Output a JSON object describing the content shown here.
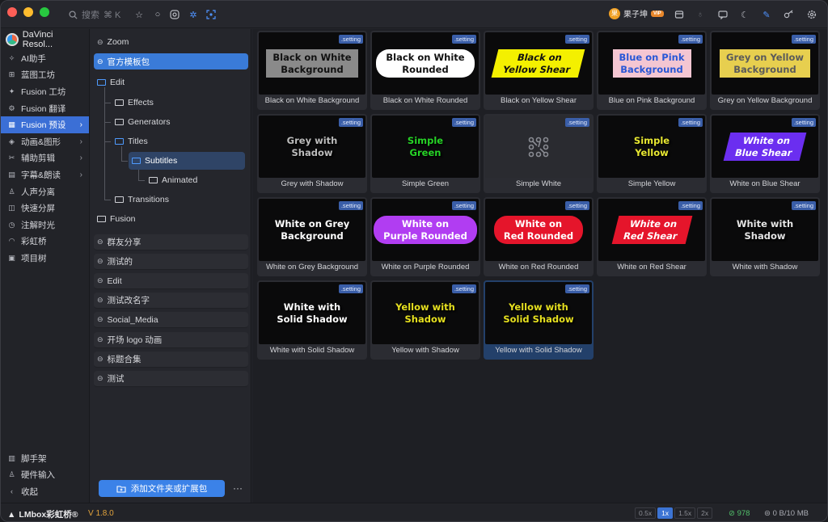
{
  "titlebar": {
    "search_placeholder": "搜索",
    "shortcut": "⌘ K",
    "user_name": "果子坤",
    "vip_label": "VIP",
    "avatar_glyph": "果"
  },
  "nav": {
    "brand": "DaVinci Resol...",
    "items": [
      {
        "label": "AI助手",
        "icon": "sparkle-icon"
      },
      {
        "label": "蓝图工坊",
        "icon": "blueprint-icon"
      },
      {
        "label": "Fusion 工坊",
        "icon": "wrench-icon"
      },
      {
        "label": "Fusion 翻译",
        "icon": "translate-icon"
      },
      {
        "label": "Fusion 预设",
        "icon": "grid-icon",
        "active": true,
        "chevron": true
      },
      {
        "label": "动画&图形",
        "icon": "motion-icon",
        "chevron": true
      },
      {
        "label": "辅助剪辑",
        "icon": "cut-icon",
        "chevron": true
      },
      {
        "label": "字幕&朗读",
        "icon": "subtitle-icon",
        "chevron": true
      },
      {
        "label": "人声分离",
        "icon": "voice-icon"
      },
      {
        "label": "快速分屏",
        "icon": "split-icon"
      },
      {
        "label": "注解时光",
        "icon": "clock-icon"
      },
      {
        "label": "彩虹桥",
        "icon": "rainbow-icon"
      },
      {
        "label": "项目树",
        "icon": "tree-icon"
      }
    ],
    "bottom": [
      {
        "label": "脚手架",
        "icon": "scaffold-icon"
      },
      {
        "label": "硬件输入",
        "icon": "hardware-icon"
      },
      {
        "label": "收起",
        "icon": "collapse-icon"
      }
    ]
  },
  "tree": {
    "zoom": "Zoom",
    "official": "官方模板包",
    "edit": "Edit",
    "effects": "Effects",
    "generators": "Generators",
    "titles": "Titles",
    "subtitles": "Subtitles",
    "animated": "Animated",
    "transitions": "Transitions",
    "fusion": "Fusion",
    "packages": [
      "群友分享",
      "测试的",
      "Edit",
      "测试改名字",
      "Social_Media",
      "开场 logo 动画",
      "标题合集",
      "测试"
    ],
    "add_button": "添加文件夹或扩展包",
    "more": "···"
  },
  "grid": {
    "badge": ".setting",
    "cards": [
      {
        "caption": "Black on White Background",
        "preview": "Black on White\nBackground",
        "fg": "#111111",
        "bg": "#8a8a8a",
        "shape": "rect"
      },
      {
        "caption": "Black on White Rounded",
        "preview": "Black on White\nRounded",
        "fg": "#111111",
        "bg": "#ffffff",
        "shape": "pill"
      },
      {
        "caption": "Black on Yellow Shear",
        "preview": "Black on\nYellow Shear",
        "fg": "#111111",
        "bg": "#f4f000",
        "shape": "shear"
      },
      {
        "caption": "Blue on Pink Background",
        "preview": "Blue on Pink\nBackground",
        "fg": "#2957d6",
        "bg": "#f4c6d2",
        "shape": "rect"
      },
      {
        "caption": "Grey on Yellow Background",
        "preview": "Grey on Yellow\nBackground",
        "fg": "#5a5a5a",
        "bg": "#e7cf4f",
        "shape": "rect"
      },
      {
        "caption": "Grey with Shadow",
        "preview": "Grey with\nShadow",
        "fg": "#bcbcbc",
        "bg": "",
        "shape": "none"
      },
      {
        "caption": "Simple Green",
        "preview": "Simple\nGreen",
        "fg": "#27d427",
        "bg": "",
        "shape": "none"
      },
      {
        "caption": "Simple White",
        "preview": "",
        "fg": "#8a8c93",
        "bg": "",
        "shape": "icon"
      },
      {
        "caption": "Simple Yellow",
        "preview": "Simple\nYellow",
        "fg": "#e8e832",
        "bg": "",
        "shape": "none"
      },
      {
        "caption": "White on Blue Shear",
        "preview": "White on\nBlue Shear",
        "fg": "#ffffff",
        "bg": "#6b2ef0",
        "shape": "shear"
      },
      {
        "caption": "White on Grey Background",
        "preview": "White on Grey\nBackground",
        "fg": "#ffffff",
        "bg": "#141414",
        "shape": "rect"
      },
      {
        "caption": "White on Purple Rounded",
        "preview": "White on\nPurple Rounded",
        "fg": "#ffffff",
        "bg": "#b13df2",
        "shape": "pill"
      },
      {
        "caption": "White on Red Rounded",
        "preview": "White on\nRed Rounded",
        "fg": "#ffffff",
        "bg": "#e5152b",
        "shape": "pill"
      },
      {
        "caption": "White on Red Shear",
        "preview": "White on\nRed Shear",
        "fg": "#ffffff",
        "bg": "#e5152b",
        "shape": "shear"
      },
      {
        "caption": "White with Shadow",
        "preview": "White with\nShadow",
        "fg": "#e4e4e4",
        "bg": "",
        "shape": "none"
      },
      {
        "caption": "White with Solid Shadow",
        "preview": "White with\nSolid Shadow",
        "fg": "#ffffff",
        "bg": "",
        "shape": "none"
      },
      {
        "caption": "Yellow with Shadow",
        "preview": "Yellow with\nShadow",
        "fg": "#e6e020",
        "bg": "",
        "shape": "none"
      },
      {
        "caption": "Yellow with Solid Shadow",
        "preview": "Yellow with\nSolid Shadow",
        "fg": "#e6e020",
        "bg": "",
        "shape": "none",
        "selected": true
      }
    ]
  },
  "status": {
    "app": "LMbox彩虹桥®",
    "version": "V 1.8.0",
    "zoom_options": [
      "0.5x",
      "1x",
      "1.5x",
      "2x"
    ],
    "zoom_selected": "1x",
    "count": "978",
    "memory": "0 B/10 MB"
  }
}
